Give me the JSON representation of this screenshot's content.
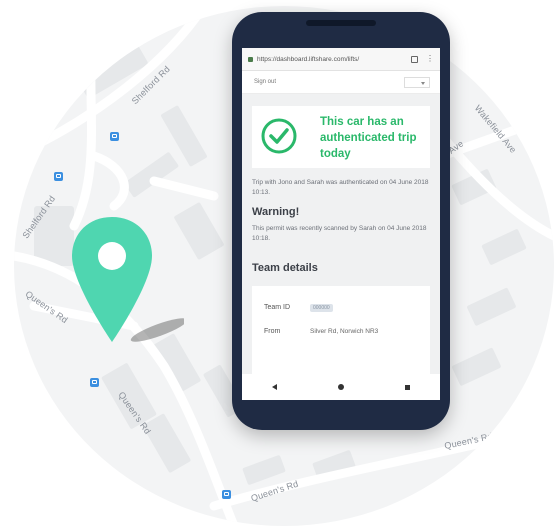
{
  "map": {
    "labels": {
      "shelford_top": "Shelford Rd",
      "shelford_left": "Shelford Rd",
      "queens_left": "Queen's Rd",
      "queens_mid": "Queen's Rd",
      "queens_bottom": "Queen's Rd",
      "queens_right": "Queen's Rd",
      "wakefield": "Wakefield Ave",
      "ave": "Ave"
    },
    "pin_color": "#4fd6b0"
  },
  "browser": {
    "url": "https://dashboard.liftshare.com/lifts/",
    "sign_out": "Sign out"
  },
  "auth": {
    "message": "This car has an authenticated trip today",
    "accent": "#2ab86a"
  },
  "trip": {
    "text": "Trip with Jono and Sarah was authenticated on 04 June 2018 10:13."
  },
  "warning": {
    "title": "Warning!",
    "text": "This permit was recently scanned by Sarah on 04 June 2018 10:18."
  },
  "team": {
    "title": "Team details",
    "id_label": "Team ID",
    "id_value": "000000",
    "from_label": "From",
    "from_value": "Silver Rd, Norwich NR3"
  },
  "nav": {
    "back": "back-icon",
    "home": "home-icon",
    "recent": "recent-apps-icon"
  }
}
